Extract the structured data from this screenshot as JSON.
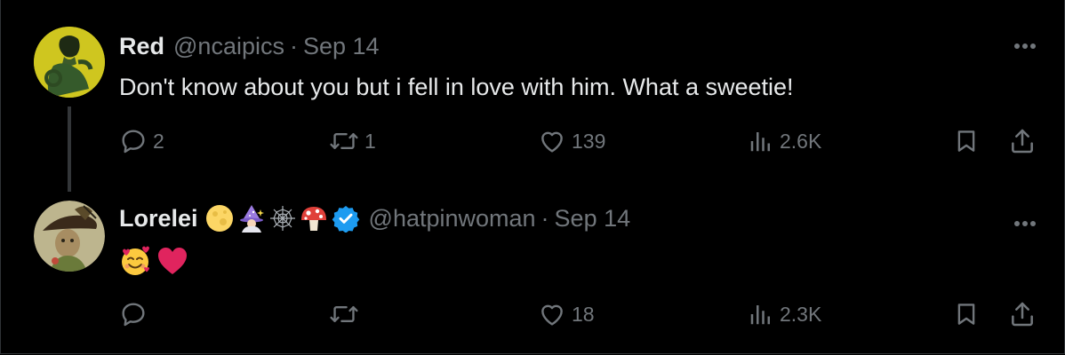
{
  "tweets": [
    {
      "author": {
        "name": "Red",
        "handle": "@ncaipics"
      },
      "separator": "·",
      "date": "Sep 14",
      "text": "Don't know about you but i fell in love with him.  What a sweetie!",
      "stats": {
        "replies": "2",
        "reposts": "1",
        "likes": "139",
        "views": "2.6K"
      }
    },
    {
      "author": {
        "name": "Lorelei",
        "handle": "@hatpinwoman",
        "name_emojis": [
          "full-moon-icon",
          "woman-mage-icon",
          "spider-web-icon",
          "mushroom-icon"
        ],
        "verified": true
      },
      "separator": "·",
      "date": "Sep 14",
      "text_emojis": [
        "smiling-face-with-hearts-icon",
        "red-heart-icon"
      ],
      "stats": {
        "replies": "",
        "reposts": "",
        "likes": "18",
        "views": "2.3K"
      }
    }
  ],
  "colors": {
    "background": "#000000",
    "primary_text": "#e7e9ea",
    "secondary_text": "#71767b",
    "divider": "#2f3336",
    "verified_badge": "#1d9bf0",
    "heart_red": "#e0245e"
  }
}
